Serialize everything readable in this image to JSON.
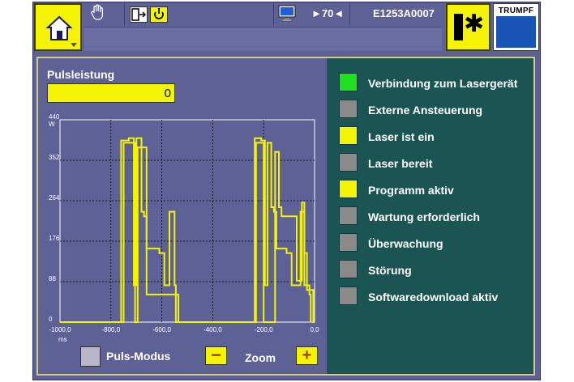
{
  "header": {
    "home_icon": "home-icon",
    "hand_icon": "hand-icon",
    "door_icon": "door-exit-icon",
    "cycle_icon": "cycle-icon",
    "monitor_icon": "monitor-icon",
    "speed": "►70◄",
    "machine_code": "E1253A0007",
    "laser_icon": "laser-icon",
    "brand": "TRUMPF"
  },
  "pulse": {
    "label": "Pulsleistung",
    "value": "0"
  },
  "controls": {
    "puls_mode": "Puls-Modus",
    "zoom_label": "Zoom",
    "zoom_minus": "−",
    "zoom_plus": "+"
  },
  "status": [
    {
      "label": "Verbindung zum Lasergerät",
      "color": "#1fe01f"
    },
    {
      "label": "Externe Ansteuerung",
      "color": "#8a8a8a"
    },
    {
      "label": "Laser ist ein",
      "color": "#f4f400"
    },
    {
      "label": "Laser bereit",
      "color": "#8a8a8a"
    },
    {
      "label": "Programm aktiv",
      "color": "#f4f400"
    },
    {
      "label": "Wartung erforderlich",
      "color": "#8a8a8a"
    },
    {
      "label": "Überwachung",
      "color": "#8a8a8a"
    },
    {
      "label": "Störung",
      "color": "#8a8a8a"
    },
    {
      "label": "Softwaredownload aktiv",
      "color": "#8a8a8a"
    }
  ],
  "chart_data": {
    "type": "line",
    "x_unit": "ms",
    "y_unit": "W",
    "xlim": [
      -1000,
      0
    ],
    "ylim": [
      0,
      440
    ],
    "x_ticks": [
      "-1000,0",
      "-800,0",
      "-600,0",
      "-400,0",
      "-200,0",
      "0,0"
    ],
    "y_ticks": [
      "0",
      "88",
      "176",
      "264",
      "352",
      "440"
    ],
    "line_color": "#f4f400",
    "grid": true,
    "series": [
      {
        "x": [
          -1000,
          -750,
          -750,
          -705,
          -705,
          -695,
          -695,
          -660,
          -660,
          -535,
          -535,
          -230,
          -230,
          -200,
          -200,
          -155,
          -155,
          -140,
          -140,
          -130,
          -130,
          -70,
          -70,
          -50,
          -50,
          -40,
          -40,
          -30,
          -30,
          -5,
          -5,
          0
        ],
        "y": [
          0,
          0,
          390,
          390,
          0,
          0,
          380,
          380,
          60,
          60,
          0,
          0,
          390,
          390,
          0,
          0,
          370,
          370,
          250,
          250,
          230,
          230,
          90,
          90,
          260,
          260,
          150,
          150,
          70,
          70,
          0,
          0
        ]
      },
      {
        "x": [
          -760,
          -760,
          -730,
          -730,
          -710,
          -710,
          -700,
          -700,
          -680,
          -680,
          -670,
          -670,
          -660,
          -660,
          -610,
          -610,
          -590,
          -590,
          -570,
          -570,
          -550,
          -550,
          -545,
          -545,
          -235,
          -235,
          -210,
          -210,
          -195,
          -195,
          -185,
          -185,
          -170,
          -170,
          -160,
          -160,
          -150,
          -150,
          -110,
          -110,
          -90,
          -90,
          -70,
          -70,
          -55,
          -55,
          -40,
          -40,
          -20,
          -20,
          -15,
          -15
        ],
        "y": [
          0,
          395,
          395,
          400,
          400,
          80,
          80,
          400,
          400,
          240,
          240,
          230,
          230,
          160,
          160,
          150,
          150,
          80,
          80,
          240,
          240,
          80,
          80,
          0,
          0,
          400,
          400,
          395,
          395,
          80,
          80,
          390,
          390,
          250,
          250,
          240,
          240,
          160,
          160,
          150,
          150,
          80,
          80,
          80,
          80,
          240,
          240,
          80,
          80,
          60,
          60,
          0
        ]
      }
    ]
  }
}
